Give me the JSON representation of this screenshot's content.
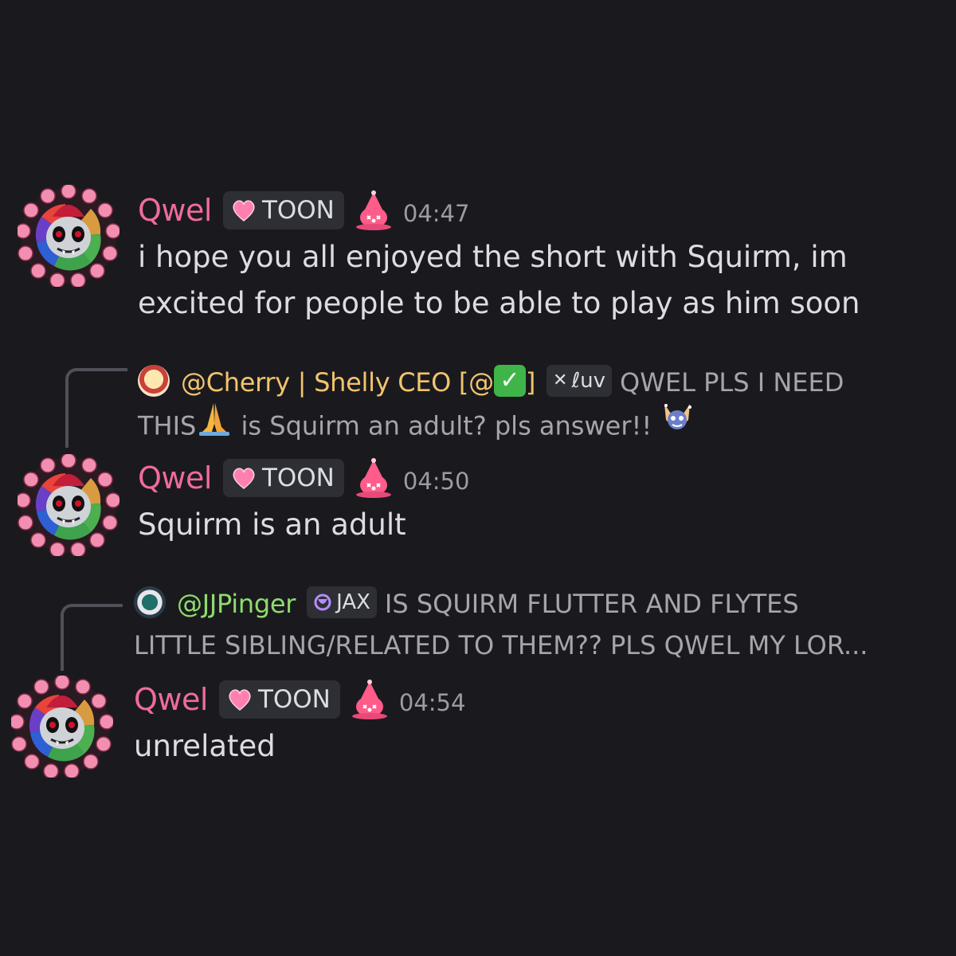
{
  "messages": [
    {
      "author": "Qwel",
      "tag": "TOON",
      "time": "04:47",
      "lines": [
        "i hope you all enjoyed the short with Squirm, im",
        "excited for people to be able to play as him soon"
      ]
    },
    {
      "reply": {
        "author": "@Cherry | Shelly CEO [@",
        "author_suffix": "]",
        "check": "✓",
        "tag": "ℓuv",
        "line1": "QWEL PLS I NEED",
        "line2a": "THIS",
        "line2b": "is Squirm an adult? pls answer!!"
      },
      "author": "Qwel",
      "tag": "TOON",
      "time": "04:50",
      "lines": [
        "Squirm is an adult"
      ]
    },
    {
      "reply": {
        "author": "@JJPinger",
        "tag": "JAX",
        "line1": "IS SQUIRM FLUTTER AND FLYTES",
        "line2": "LITTLE SIBLING/RELATED TO THEM?? PLS QWEL MY LOR..."
      },
      "author": "Qwel",
      "tag": "TOON",
      "time": "04:54",
      "lines": [
        "unrelated"
      ]
    }
  ],
  "colors": {
    "background": "#1a1a1e",
    "qwel": "#f06b9c",
    "cherry": "#f2c46d",
    "jjpinger": "#8fdc6d",
    "tag_bg": "#2e2f35"
  },
  "icons": [
    "pink-heart-icon",
    "pink-clown-role-icon",
    "butterfly-icon",
    "moon-icon",
    "pray-icon",
    "cat-emoji-icon",
    "check-icon"
  ]
}
